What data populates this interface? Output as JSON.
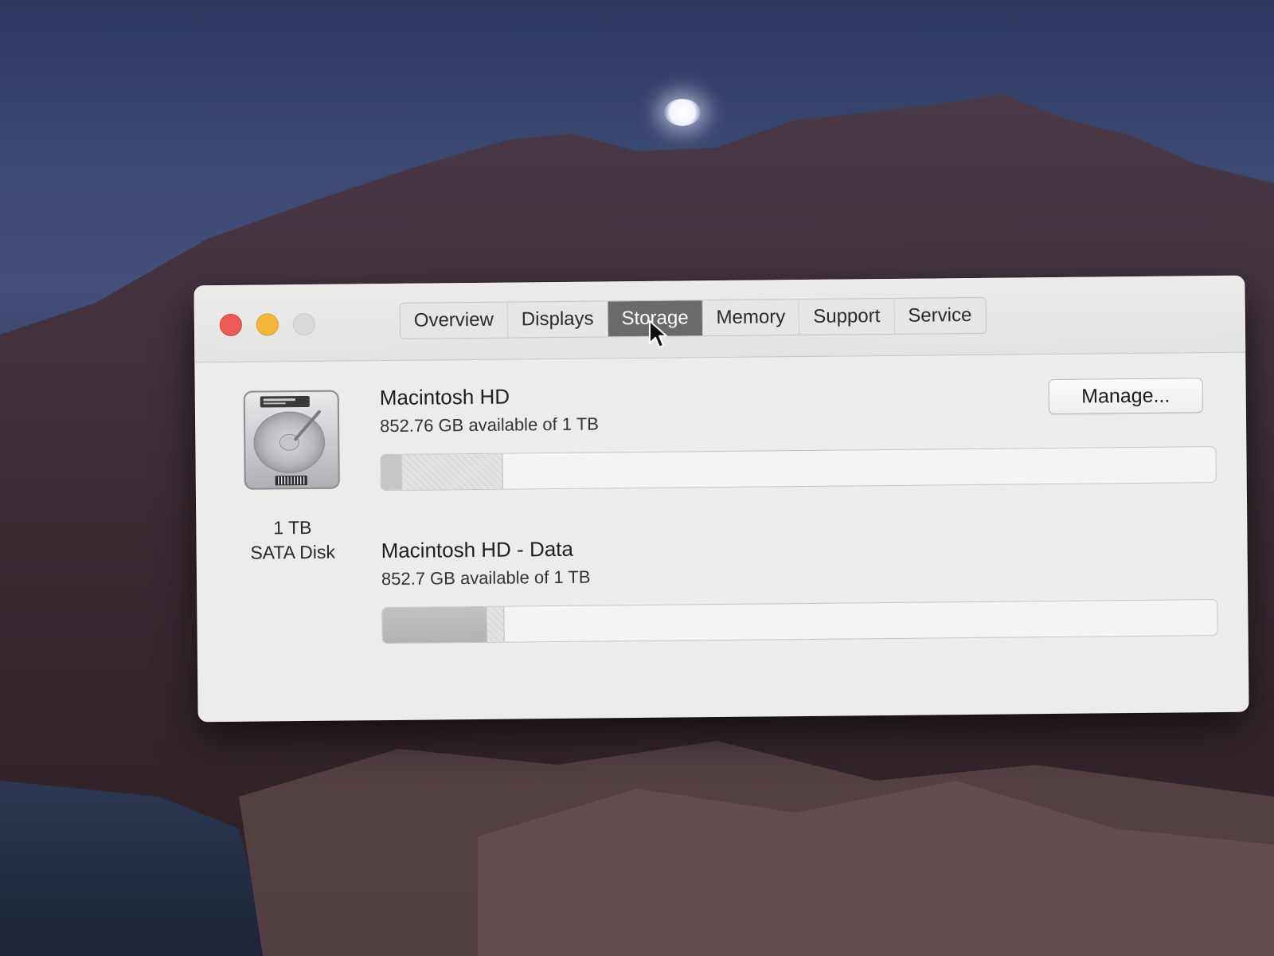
{
  "window": {
    "tabs": [
      {
        "label": "Overview"
      },
      {
        "label": "Displays"
      },
      {
        "label": "Storage"
      },
      {
        "label": "Memory"
      },
      {
        "label": "Support"
      },
      {
        "label": "Service"
      }
    ],
    "active_tab": "Storage"
  },
  "disk": {
    "size": "1 TB",
    "type": "SATA Disk",
    "icon": "hard-drive-icon"
  },
  "volumes": [
    {
      "name": "Macintosh HD",
      "available": "852.76 GB available of 1 TB",
      "segments": [
        {
          "kind": "system",
          "fraction": 0.025
        },
        {
          "kind": "other",
          "fraction": 0.12
        }
      ]
    },
    {
      "name": "Macintosh HD - Data",
      "available": "852.7 GB available of 1 TB",
      "segments": [
        {
          "kind": "used",
          "fraction": 0.125
        },
        {
          "kind": "other",
          "fraction": 0.02
        }
      ]
    }
  ],
  "actions": {
    "manage_label": "Manage..."
  },
  "colors": {
    "close": "#ee5b55",
    "minimize": "#f3b73a",
    "zoom_disabled": "#d9d9d7",
    "active_tab": "#6a6a6a",
    "window_bg": "#ececea"
  }
}
